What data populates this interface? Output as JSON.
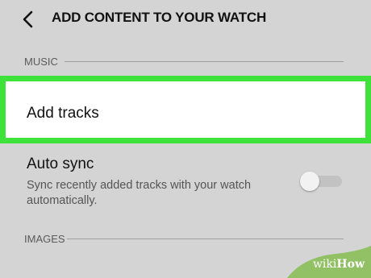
{
  "header": {
    "title": "ADD CONTENT TO YOUR WATCH",
    "back_icon": "chevron-left-icon"
  },
  "sections": {
    "music": {
      "label": "MUSIC",
      "add_tracks_label": "Add tracks",
      "highlight_color": "#3ee23a"
    },
    "auto_sync": {
      "title": "Auto sync",
      "description": "Sync recently added tracks with your watch automatically.",
      "toggle_state": "off"
    },
    "images": {
      "label": "IMAGES"
    }
  },
  "watermark": {
    "wiki": "wiki",
    "how": "How"
  }
}
